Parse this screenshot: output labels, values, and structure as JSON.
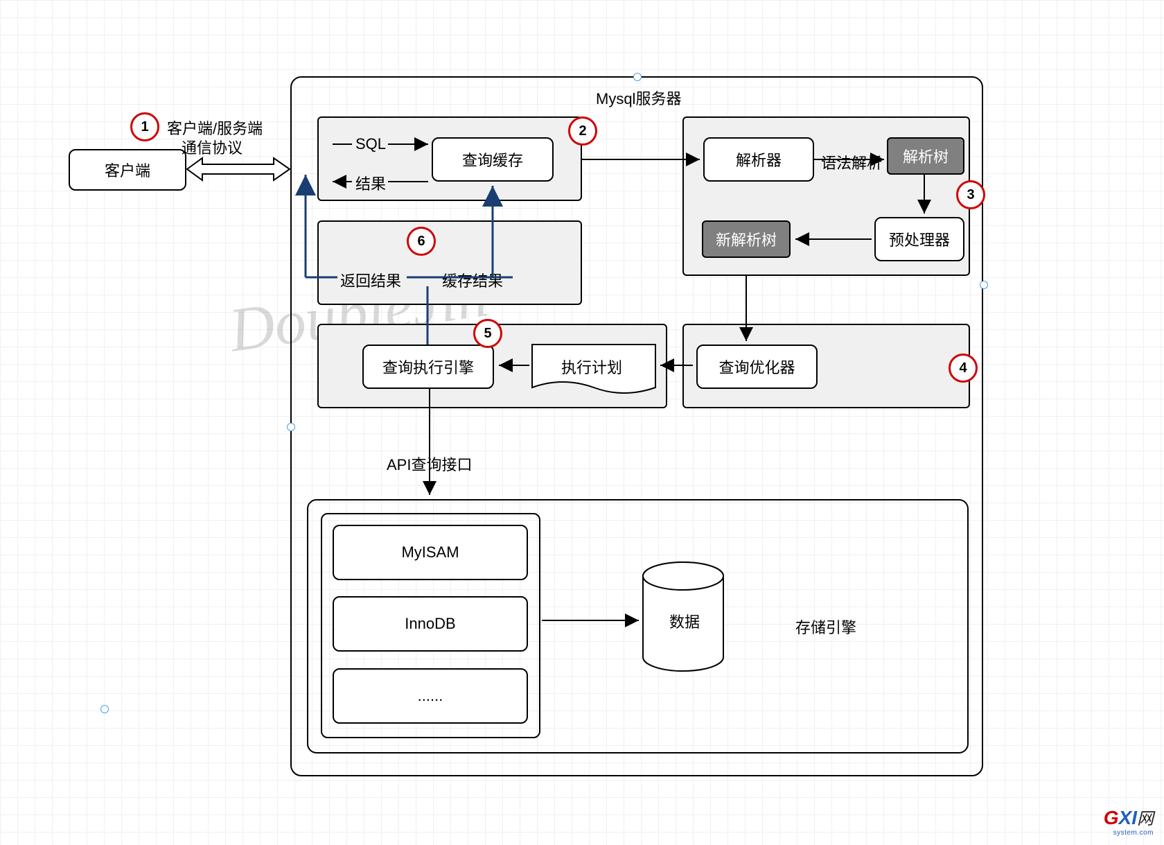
{
  "diagram": {
    "client": "客户端",
    "server_title": "Mysql服务器",
    "protocol_line1": "客户端/服务端",
    "protocol_line2": "通信协议",
    "sql_label": "SQL",
    "result_label": "结果",
    "query_cache": "查询缓存",
    "parser": "解析器",
    "grammar_parse": "语法解析",
    "parse_tree": "解析树",
    "preprocessor": "预处理器",
    "new_parse_tree": "新解析树",
    "return_result": "返回结果",
    "cache_result": "缓存结果",
    "query_exec_engine": "查询执行引擎",
    "exec_plan": "执行计划",
    "query_optimizer": "查询优化器",
    "api_interface": "API查询接口",
    "engine_myisam": "MyISAM",
    "engine_innodb": "InnoDB",
    "engine_more": "......",
    "data": "数据",
    "storage_engine": "存储引擎",
    "watermark": "DoubleJin",
    "steps": {
      "s1": "1",
      "s2": "2",
      "s3": "3",
      "s4": "4",
      "s5": "5",
      "s6": "6"
    },
    "footer": {
      "g": "G",
      "xi": "XI",
      "wang": "网",
      "sub": "system.com"
    }
  }
}
